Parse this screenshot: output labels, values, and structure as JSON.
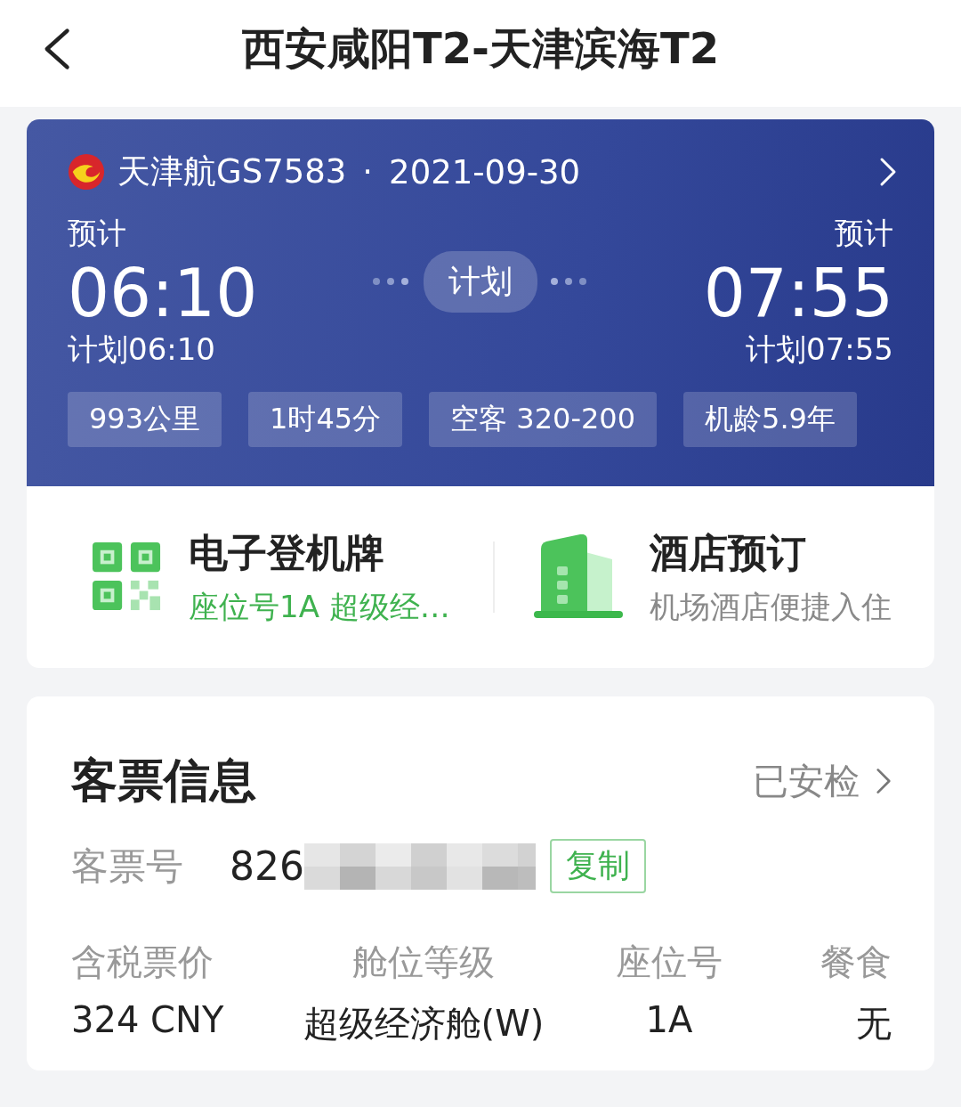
{
  "header": {
    "title": "西安咸阳T2-天津滨海T2"
  },
  "flight": {
    "airline_flight": "天津航GS7583",
    "separator": "·",
    "date": "2021-09-30",
    "departure": {
      "estimate_label": "预计",
      "time": "06:10",
      "scheduled": "计划06:10"
    },
    "status": "计划",
    "arrival": {
      "estimate_label": "预计",
      "time": "07:55",
      "scheduled": "计划07:55"
    },
    "tags": [
      "993公里",
      "1时45分",
      "空客 320-200",
      "机龄5.9年"
    ]
  },
  "services": [
    {
      "kind": "boarding_pass",
      "title": "电子登机牌",
      "subtitle": "座位号1A 超级经…"
    },
    {
      "kind": "hotel",
      "title": "酒店预订",
      "subtitle": "机场酒店便捷入住"
    }
  ],
  "ticket": {
    "title": "客票信息",
    "status": "已安检",
    "number_label": "客票号",
    "number_visible": "826",
    "copy_button": "复制",
    "columns": [
      {
        "label": "含税票价",
        "value": "324 CNY"
      },
      {
        "label": "舱位等级",
        "value": "超级经济舱(W)"
      },
      {
        "label": "座位号",
        "value": "1A"
      },
      {
        "label": "餐食",
        "value": "无"
      }
    ]
  }
}
